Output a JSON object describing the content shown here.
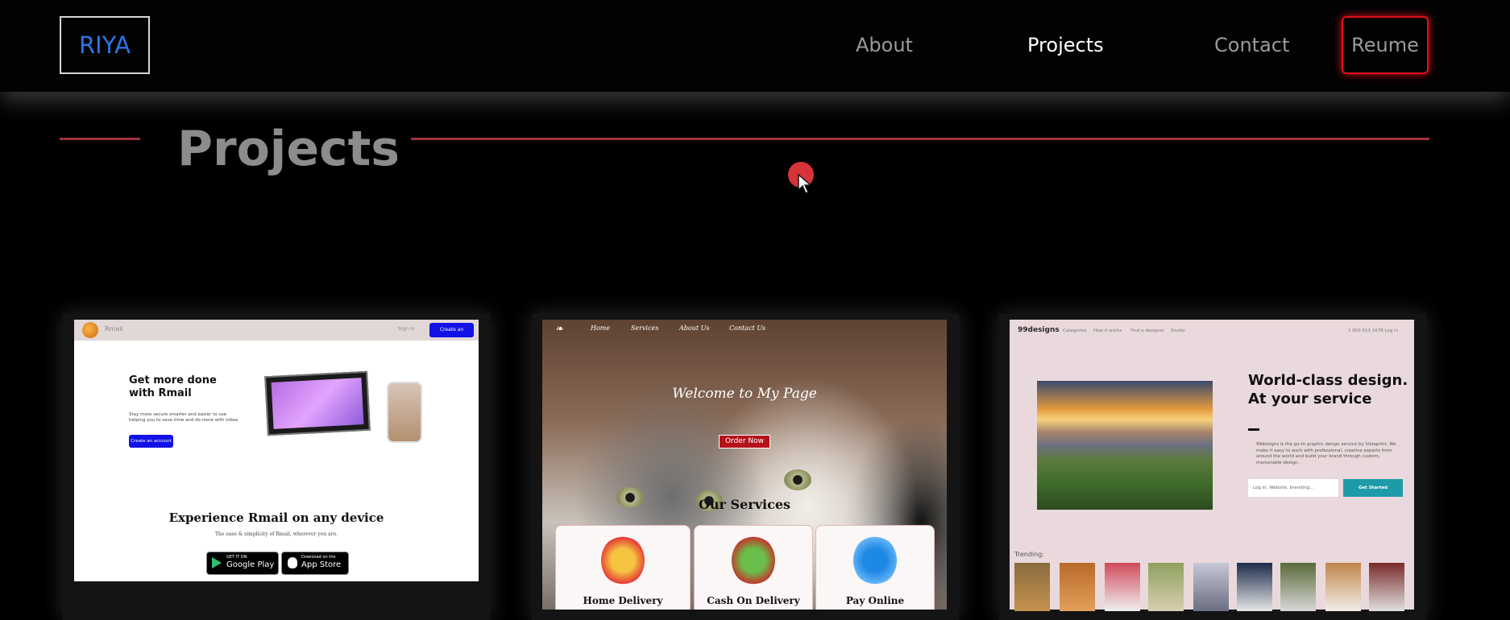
{
  "header": {
    "logo": "RIYA",
    "nav": {
      "about": "About",
      "projects": "Projects",
      "contact": "Contact"
    },
    "resume_label": "Reume"
  },
  "section": {
    "title": "Projects"
  },
  "colors": {
    "accent_red": "#e0101e",
    "logo_blue": "#2f74e8",
    "divider": "#a03040",
    "background": "#000000"
  },
  "projects": [
    {
      "brand": "Rmail",
      "links": [
        "Sign in"
      ],
      "nav_cta": "Create an account",
      "headline": "Get more done with Rmail",
      "body": "Stay more secure smarter and easier to use helping you to save time and do more with inbox.",
      "button": "Create an account",
      "subhead": "Experience Rmail on any device",
      "subtext": "The ease & simplicity of Rmail, wherever you are.",
      "stores": [
        {
          "small": "GET IT ON",
          "big": "Google Play",
          "icon": "google-play-icon"
        },
        {
          "small": "Download on the",
          "big": "App Store",
          "icon": "apple-icon"
        }
      ]
    },
    {
      "nav": [
        "Home",
        "Services",
        "About Us",
        "Contact Us"
      ],
      "welcome": "Welcome to My Page",
      "button": "Order Now",
      "services_title": "Our Services",
      "services": [
        "Home Delivery",
        "Cash On Delivery",
        "Pay Online"
      ]
    },
    {
      "logo": "99designs",
      "nav": [
        "Categories",
        "How it works",
        "Find a designer",
        "Studio"
      ],
      "phone": "1 800 513 1678   Log in",
      "headline": "World-class design. At your service",
      "body": "99designs is the go-to graphic design service by Vistaprint. We make it easy to work with professional, creative experts from around the world and build your brand through custom, memorable design.",
      "input_placeholder": "Log in, Website, branding...",
      "button": "Get Started",
      "trending_label": "Trending:"
    }
  ]
}
